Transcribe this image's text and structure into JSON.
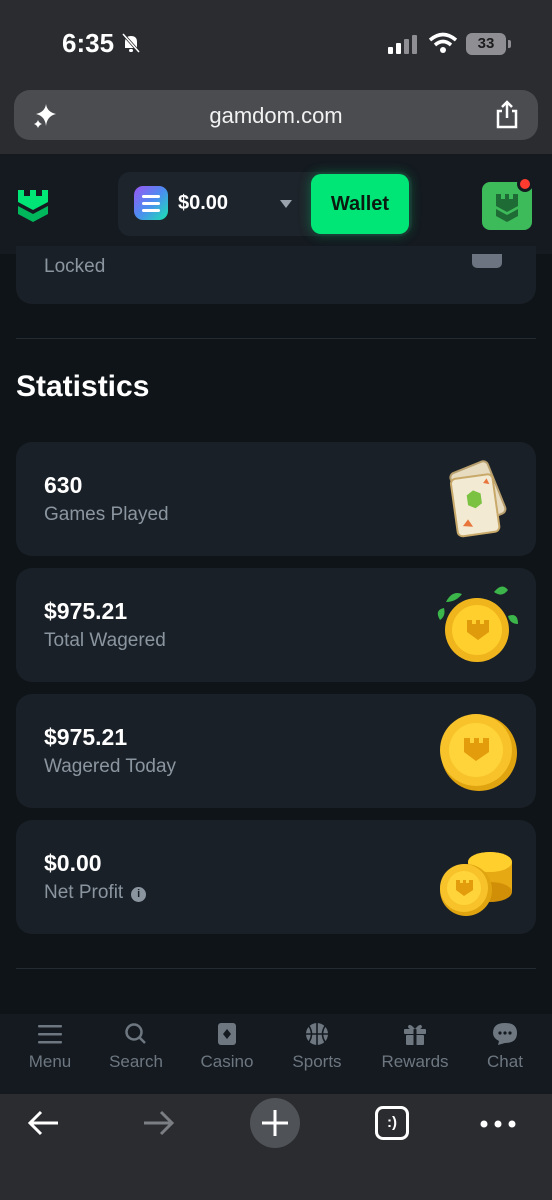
{
  "status_bar": {
    "time": "6:35",
    "battery": "33"
  },
  "browser": {
    "url": "gamdom.com",
    "tabs_label": ":)"
  },
  "header": {
    "balance": "$0.00",
    "wallet_label": "Wallet"
  },
  "locked": {
    "label": "Locked"
  },
  "statistics": {
    "title": "Statistics",
    "cards": [
      {
        "value": "630",
        "label": "Games Played"
      },
      {
        "value": "$975.21",
        "label": "Total Wagered"
      },
      {
        "value": "$975.21",
        "label": "Wagered Today"
      },
      {
        "value": "$0.00",
        "label": "Net Profit",
        "info_glyph": "i"
      }
    ]
  },
  "bottom_nav": {
    "items": [
      {
        "label": "Menu"
      },
      {
        "label": "Search"
      },
      {
        "label": "Casino"
      },
      {
        "label": "Sports"
      },
      {
        "label": "Rewards"
      },
      {
        "label": "Chat"
      }
    ]
  },
  "colors": {
    "accent": "#00e676",
    "background": "#0f1419",
    "card": "#1a2027",
    "muted_text": "#8b95a0"
  }
}
